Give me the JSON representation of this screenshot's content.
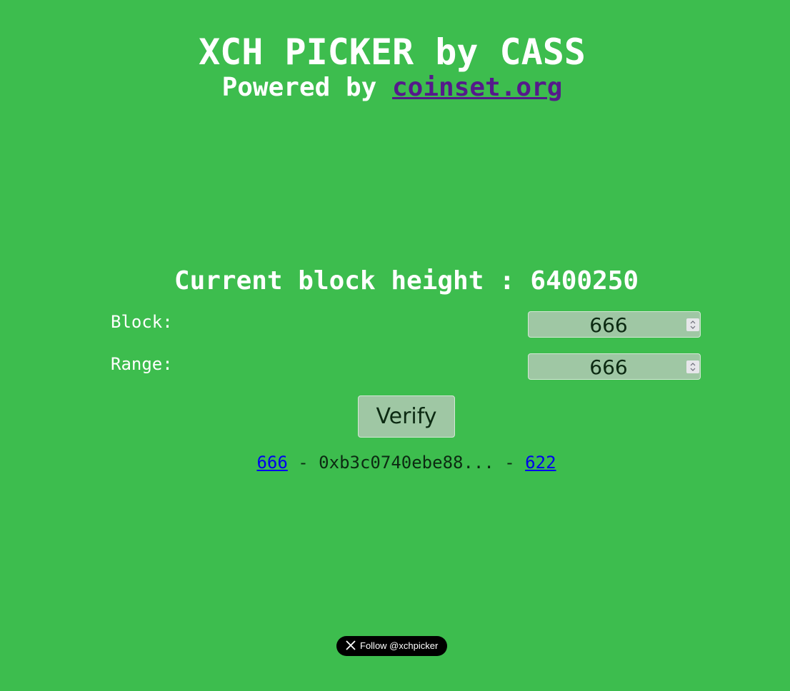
{
  "header": {
    "title": "XCH PICKER by CASS",
    "powered_prefix": "Powered by ",
    "powered_link": "coinset.org"
  },
  "status": {
    "current_height": "Current block height : 6400250"
  },
  "form": {
    "block_label": "Block:",
    "block_value": "666",
    "range_label": "Range:",
    "range_value": "666",
    "verify_label": "Verify"
  },
  "result": {
    "block_link": "666",
    "sep1": " - ",
    "hash": "0xb3c0740ebe88...",
    "sep2": " - ",
    "picked_link": "622"
  },
  "footer": {
    "follow_label": "Follow @xchpicker"
  },
  "colors": {
    "background": "#3dbd4e",
    "input_bg": "#9fc7a4",
    "link_visited": "#551a8b",
    "link": "#0000ee"
  }
}
